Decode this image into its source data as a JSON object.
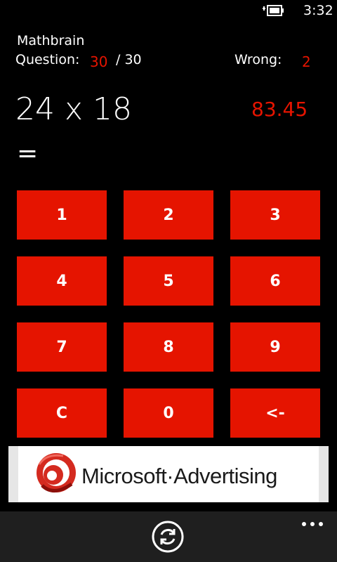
{
  "status_bar": {
    "time": "3:32",
    "battery_icon": "battery-charging-icon"
  },
  "header": {
    "app_title": "Mathbrain",
    "question_label": "Question:",
    "question_current": "30",
    "question_total": "/ 30",
    "wrong_label": "Wrong:",
    "wrong_count": "2"
  },
  "problem": {
    "expression": "24 x 18",
    "timer": "83.45",
    "equals": "=",
    "answer": ""
  },
  "keypad": {
    "keys": [
      "1",
      "2",
      "3",
      "4",
      "5",
      "6",
      "7",
      "8",
      "9",
      "C",
      "0",
      "<-"
    ]
  },
  "ad": {
    "text": "Microsoft·Advertising",
    "logo_icon": "microsoft-advertising-logo"
  },
  "app_bar": {
    "refresh_icon": "refresh-icon",
    "more_icon": "ellipsis-icon"
  },
  "colors": {
    "accent": "#e51400",
    "background": "#000000",
    "app_bar": "#1f1f1f"
  }
}
